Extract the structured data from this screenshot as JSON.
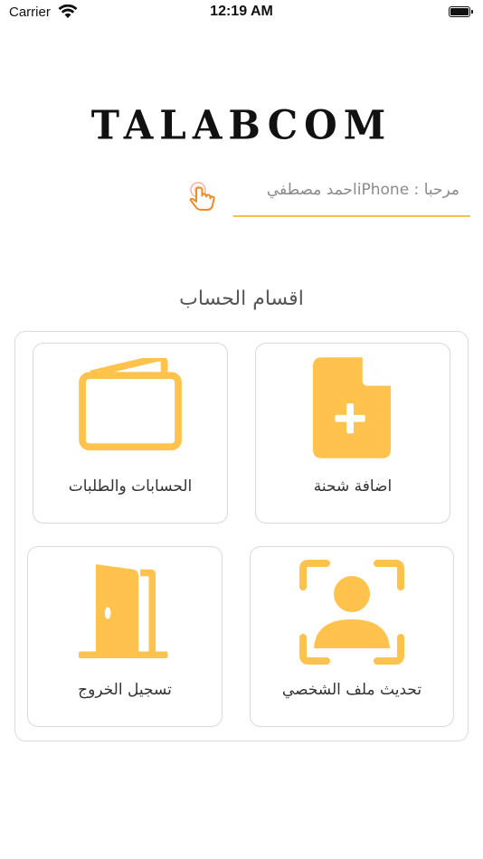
{
  "status_bar": {
    "carrier": "Carrier",
    "time": "12:19 AM"
  },
  "app": {
    "logo_text": "TALABCOM",
    "welcome_text": "مرحبا : iPhoneاحمد مصطفي",
    "section_title": "اقسام الحساب"
  },
  "cards": [
    {
      "label": "اضافة شحنة",
      "icon": "add-file-icon"
    },
    {
      "label": "الحسابات والطلبات",
      "icon": "wallet-icon"
    },
    {
      "label": "تحديث ملف الشخصي",
      "icon": "user-scan-icon"
    },
    {
      "label": "تسجيل الخروج",
      "icon": "door-exit-icon"
    }
  ],
  "colors": {
    "accent": "#ffc24d",
    "underline": "#f3c14c",
    "hand_orange": "#f08a24"
  }
}
